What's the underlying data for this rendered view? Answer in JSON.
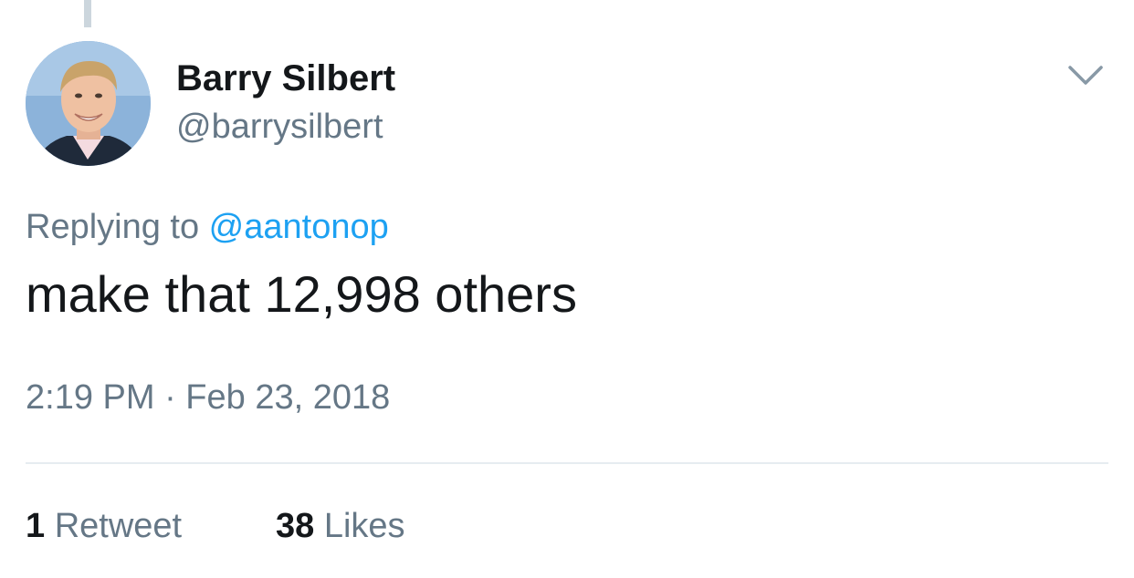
{
  "user": {
    "display_name": "Barry Silbert",
    "handle": "@barrysilbert"
  },
  "reply": {
    "prefix": "Replying to ",
    "mention": "@aantonop"
  },
  "tweet": {
    "text": "make that 12,998 others",
    "timestamp": "2:19 PM · Feb 23, 2018"
  },
  "stats": {
    "retweets_count": "1",
    "retweets_label": "Retweet",
    "likes_count": "38",
    "likes_label": "Likes"
  },
  "icons": {
    "menu": "chevron-down-icon"
  },
  "colors": {
    "link": "#1da1f2",
    "secondary_text": "#657786",
    "primary_text": "#14171a",
    "divider": "#e6ecf0"
  }
}
